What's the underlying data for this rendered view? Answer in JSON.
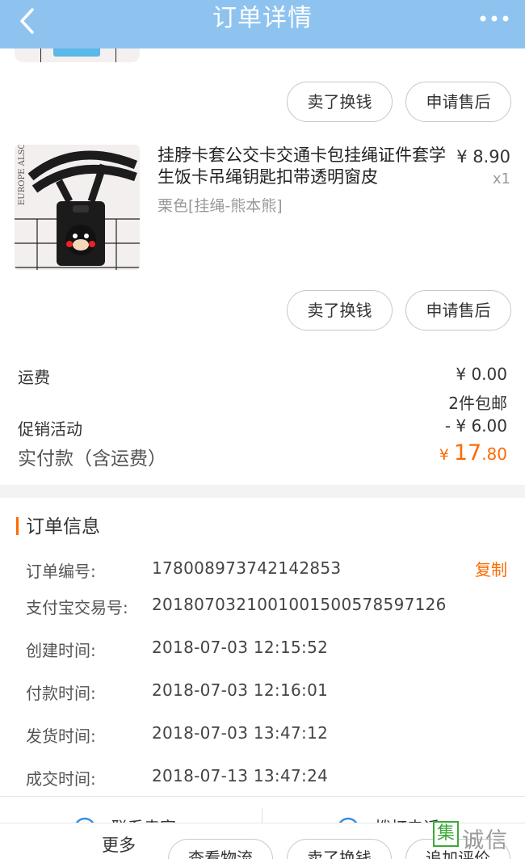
{
  "header": {
    "title": "订单详情",
    "back_icon": "chevron-left-icon",
    "more_icon": "more-dots-icon"
  },
  "item_actions": {
    "sell_label": "卖了换钱",
    "aftersale_label": "申请售后"
  },
  "product": {
    "name": "挂脖卡套公交卡交通卡包挂绳证件套学生饭卡吊绳钥匙扣带透明窗皮",
    "sku": "栗色[挂绳-熊本熊]",
    "price": "¥ 8.90",
    "qty": "x1",
    "image_text": "EUROPE ALSO"
  },
  "summary": {
    "shipping_label": "运费",
    "shipping_value": "¥ 0.00",
    "shipping_note": "2件包邮",
    "promo_label": "促销活动",
    "promo_value": "- ¥ 6.00",
    "paid_label": "实付款（含运费）",
    "paid_symbol": "¥ ",
    "paid_int": "17",
    "paid_dec": ".80"
  },
  "order_info": {
    "title": "订单信息",
    "copy_label": "复制",
    "rows": [
      {
        "label": "订单编号:",
        "value": "178008973742142853"
      },
      {
        "label": "支付宝交易号:",
        "value": "2018070321001001500578597126"
      },
      {
        "label": "创建时间:",
        "value": "2018-07-03 12:15:52"
      },
      {
        "label": "付款时间:",
        "value": "2018-07-03 12:16:01"
      },
      {
        "label": "发货时间:",
        "value": "2018-07-03 13:47:12"
      },
      {
        "label": "成交时间:",
        "value": "2018-07-13 13:47:24"
      }
    ]
  },
  "contact": {
    "seller_label": "联系卖家",
    "call_label": "拨打电话"
  },
  "bottom_bar": {
    "more_label": "更多",
    "logistics_label": "查看物流",
    "sell_label": "卖了换钱",
    "review_label": "追加评价"
  },
  "watermark": {
    "box_char": "集",
    "text": "诚信"
  },
  "colors": {
    "navbar": "#8ec3ef",
    "accent": "#ff6a00"
  }
}
